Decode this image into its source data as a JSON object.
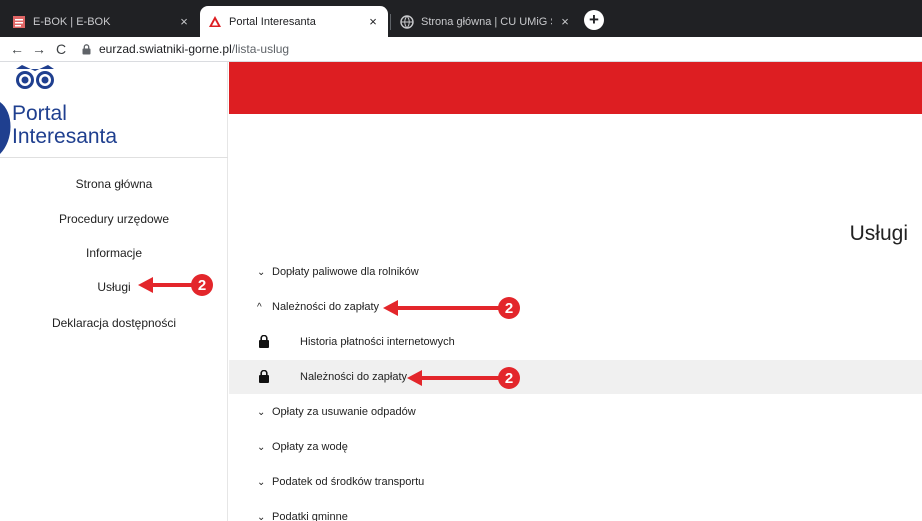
{
  "browser": {
    "tabs": [
      {
        "title": "E-BOK | E-BOK",
        "close": "×"
      },
      {
        "title": "Portal Interesanta",
        "close": "×"
      },
      {
        "title": "Strona główna | CU UMiG Świątni",
        "close": "×"
      }
    ],
    "new_tab": "+",
    "nav": {
      "back": "←",
      "forward": "→",
      "reload": "C"
    },
    "url_host": "eurzad.swiatniki-gorne.pl",
    "url_path": "/lista-uslug"
  },
  "logo": {
    "line1": "Portal",
    "line2": "Interesanta"
  },
  "sidebar": {
    "items": [
      {
        "label": "Strona główna"
      },
      {
        "label": "Procedury urzędowe"
      },
      {
        "label": "Informacje"
      },
      {
        "label": "Usługi"
      },
      {
        "label": "Deklaracja dostępności"
      }
    ]
  },
  "main": {
    "heading": "Usługi",
    "rows": [
      {
        "label": "Dopłaty paliwowe dla rolników",
        "chevron": "⌄"
      },
      {
        "label": "Należności do zapłaty",
        "chevron": "^"
      },
      {
        "label": "Historia płatności internetowych"
      },
      {
        "label": "Należności do zapłaty"
      },
      {
        "label": "Opłaty za usuwanie odpadów",
        "chevron": "⌄"
      },
      {
        "label": "Opłaty za wodę",
        "chevron": "⌄"
      },
      {
        "label": "Podatek od środków transportu",
        "chevron": "⌄"
      },
      {
        "label": "Podatki gminne",
        "chevron": "⌄"
      }
    ]
  },
  "callout_number": "2",
  "colors": {
    "brand_red": "#dd1e22",
    "callout_red": "#e3262b",
    "logo_blue": "#1f3f8f"
  }
}
